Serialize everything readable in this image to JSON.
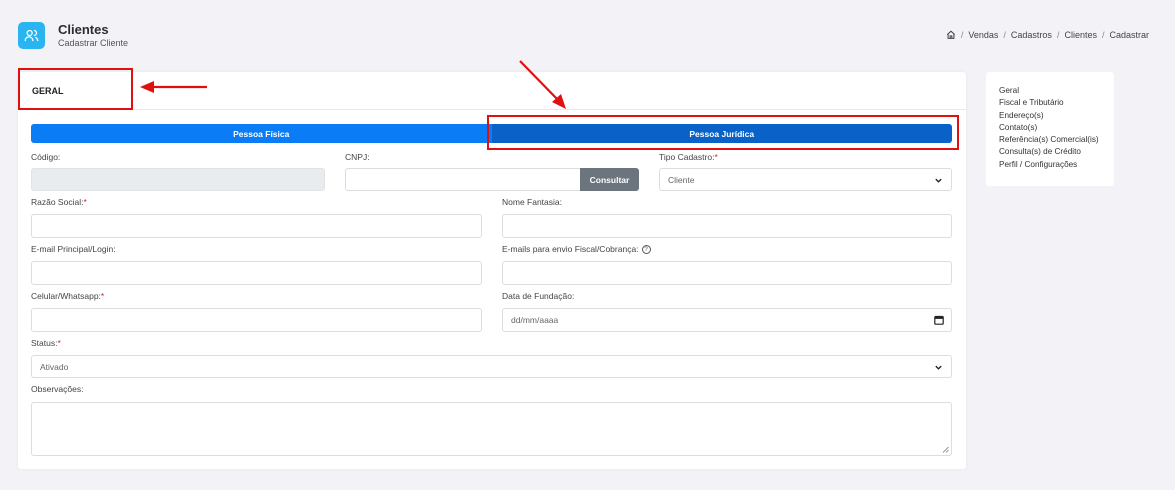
{
  "header": {
    "title": "Clientes",
    "subtitle": "Cadastrar Cliente",
    "breadcrumb": [
      "Vendas",
      "Cadastros",
      "Clientes",
      "Cadastrar"
    ]
  },
  "card": {
    "title": "GERAL",
    "tabs": {
      "pessoa_fisica": "Pessoa Física",
      "pessoa_juridica": "Pessoa Jurídica",
      "active": "pessoa_juridica"
    }
  },
  "form": {
    "codigo_label": "Código:",
    "cnpj_label": "CNPJ:",
    "consultar_button": "Consultar",
    "tipo_cadastro_label": "Tipo Cadastro:",
    "tipo_cadastro_value": "Cliente",
    "razao_social_label": "Razão Social:",
    "nome_fantasia_label": "Nome Fantasia:",
    "email_principal_label": "E-mail Principal/Login:",
    "emails_fiscal_label": "E-mails para envio Fiscal/Cobrança:",
    "celular_label": "Celular/Whatsapp:",
    "data_fundacao_label": "Data de Fundação:",
    "data_fundacao_placeholder": "dd/mm/aaaa",
    "status_label": "Status:",
    "status_value": "Ativado",
    "observacoes_label": "Observações:",
    "required_mark": "*",
    "help_mark": "?"
  },
  "side_menu": {
    "items": [
      "Geral",
      "Fiscal e Tributário",
      "Endereço(s)",
      "Contato(s)",
      "Referência(s) Comercial(is)",
      "Consulta(s) de Crédito",
      "Perfil / Configurações"
    ]
  },
  "colors": {
    "accent": "#2ab5f0",
    "tab_primary": "#0a7cf5",
    "tab_active": "#0a62c8",
    "annotation": "#e01010",
    "button_secondary": "#6c757d"
  }
}
